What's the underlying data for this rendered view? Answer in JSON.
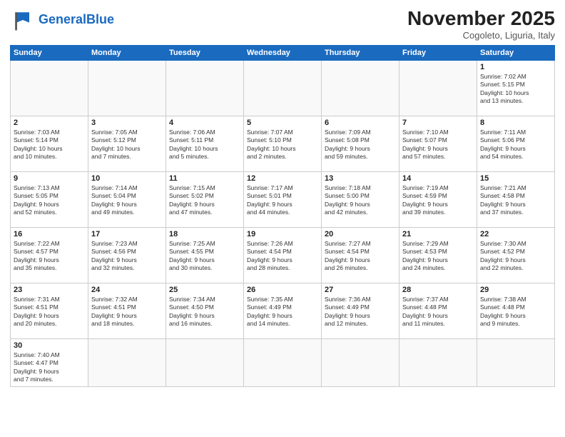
{
  "header": {
    "logo_general": "General",
    "logo_blue": "Blue",
    "month_year": "November 2025",
    "location": "Cogoleto, Liguria, Italy"
  },
  "weekdays": [
    "Sunday",
    "Monday",
    "Tuesday",
    "Wednesday",
    "Thursday",
    "Friday",
    "Saturday"
  ],
  "weeks": [
    [
      {
        "day": "",
        "info": ""
      },
      {
        "day": "",
        "info": ""
      },
      {
        "day": "",
        "info": ""
      },
      {
        "day": "",
        "info": ""
      },
      {
        "day": "",
        "info": ""
      },
      {
        "day": "",
        "info": ""
      },
      {
        "day": "1",
        "info": "Sunrise: 7:02 AM\nSunset: 5:15 PM\nDaylight: 10 hours\nand 13 minutes."
      }
    ],
    [
      {
        "day": "2",
        "info": "Sunrise: 7:03 AM\nSunset: 5:14 PM\nDaylight: 10 hours\nand 10 minutes."
      },
      {
        "day": "3",
        "info": "Sunrise: 7:05 AM\nSunset: 5:12 PM\nDaylight: 10 hours\nand 7 minutes."
      },
      {
        "day": "4",
        "info": "Sunrise: 7:06 AM\nSunset: 5:11 PM\nDaylight: 10 hours\nand 5 minutes."
      },
      {
        "day": "5",
        "info": "Sunrise: 7:07 AM\nSunset: 5:10 PM\nDaylight: 10 hours\nand 2 minutes."
      },
      {
        "day": "6",
        "info": "Sunrise: 7:09 AM\nSunset: 5:08 PM\nDaylight: 9 hours\nand 59 minutes."
      },
      {
        "day": "7",
        "info": "Sunrise: 7:10 AM\nSunset: 5:07 PM\nDaylight: 9 hours\nand 57 minutes."
      },
      {
        "day": "8",
        "info": "Sunrise: 7:11 AM\nSunset: 5:06 PM\nDaylight: 9 hours\nand 54 minutes."
      }
    ],
    [
      {
        "day": "9",
        "info": "Sunrise: 7:13 AM\nSunset: 5:05 PM\nDaylight: 9 hours\nand 52 minutes."
      },
      {
        "day": "10",
        "info": "Sunrise: 7:14 AM\nSunset: 5:04 PM\nDaylight: 9 hours\nand 49 minutes."
      },
      {
        "day": "11",
        "info": "Sunrise: 7:15 AM\nSunset: 5:02 PM\nDaylight: 9 hours\nand 47 minutes."
      },
      {
        "day": "12",
        "info": "Sunrise: 7:17 AM\nSunset: 5:01 PM\nDaylight: 9 hours\nand 44 minutes."
      },
      {
        "day": "13",
        "info": "Sunrise: 7:18 AM\nSunset: 5:00 PM\nDaylight: 9 hours\nand 42 minutes."
      },
      {
        "day": "14",
        "info": "Sunrise: 7:19 AM\nSunset: 4:59 PM\nDaylight: 9 hours\nand 39 minutes."
      },
      {
        "day": "15",
        "info": "Sunrise: 7:21 AM\nSunset: 4:58 PM\nDaylight: 9 hours\nand 37 minutes."
      }
    ],
    [
      {
        "day": "16",
        "info": "Sunrise: 7:22 AM\nSunset: 4:57 PM\nDaylight: 9 hours\nand 35 minutes."
      },
      {
        "day": "17",
        "info": "Sunrise: 7:23 AM\nSunset: 4:56 PM\nDaylight: 9 hours\nand 32 minutes."
      },
      {
        "day": "18",
        "info": "Sunrise: 7:25 AM\nSunset: 4:55 PM\nDaylight: 9 hours\nand 30 minutes."
      },
      {
        "day": "19",
        "info": "Sunrise: 7:26 AM\nSunset: 4:54 PM\nDaylight: 9 hours\nand 28 minutes."
      },
      {
        "day": "20",
        "info": "Sunrise: 7:27 AM\nSunset: 4:54 PM\nDaylight: 9 hours\nand 26 minutes."
      },
      {
        "day": "21",
        "info": "Sunrise: 7:29 AM\nSunset: 4:53 PM\nDaylight: 9 hours\nand 24 minutes."
      },
      {
        "day": "22",
        "info": "Sunrise: 7:30 AM\nSunset: 4:52 PM\nDaylight: 9 hours\nand 22 minutes."
      }
    ],
    [
      {
        "day": "23",
        "info": "Sunrise: 7:31 AM\nSunset: 4:51 PM\nDaylight: 9 hours\nand 20 minutes."
      },
      {
        "day": "24",
        "info": "Sunrise: 7:32 AM\nSunset: 4:51 PM\nDaylight: 9 hours\nand 18 minutes."
      },
      {
        "day": "25",
        "info": "Sunrise: 7:34 AM\nSunset: 4:50 PM\nDaylight: 9 hours\nand 16 minutes."
      },
      {
        "day": "26",
        "info": "Sunrise: 7:35 AM\nSunset: 4:49 PM\nDaylight: 9 hours\nand 14 minutes."
      },
      {
        "day": "27",
        "info": "Sunrise: 7:36 AM\nSunset: 4:49 PM\nDaylight: 9 hours\nand 12 minutes."
      },
      {
        "day": "28",
        "info": "Sunrise: 7:37 AM\nSunset: 4:48 PM\nDaylight: 9 hours\nand 11 minutes."
      },
      {
        "day": "29",
        "info": "Sunrise: 7:38 AM\nSunset: 4:48 PM\nDaylight: 9 hours\nand 9 minutes."
      }
    ],
    [
      {
        "day": "30",
        "info": "Sunrise: 7:40 AM\nSunset: 4:47 PM\nDaylight: 9 hours\nand 7 minutes."
      },
      {
        "day": "",
        "info": ""
      },
      {
        "day": "",
        "info": ""
      },
      {
        "day": "",
        "info": ""
      },
      {
        "day": "",
        "info": ""
      },
      {
        "day": "",
        "info": ""
      },
      {
        "day": "",
        "info": ""
      }
    ]
  ]
}
